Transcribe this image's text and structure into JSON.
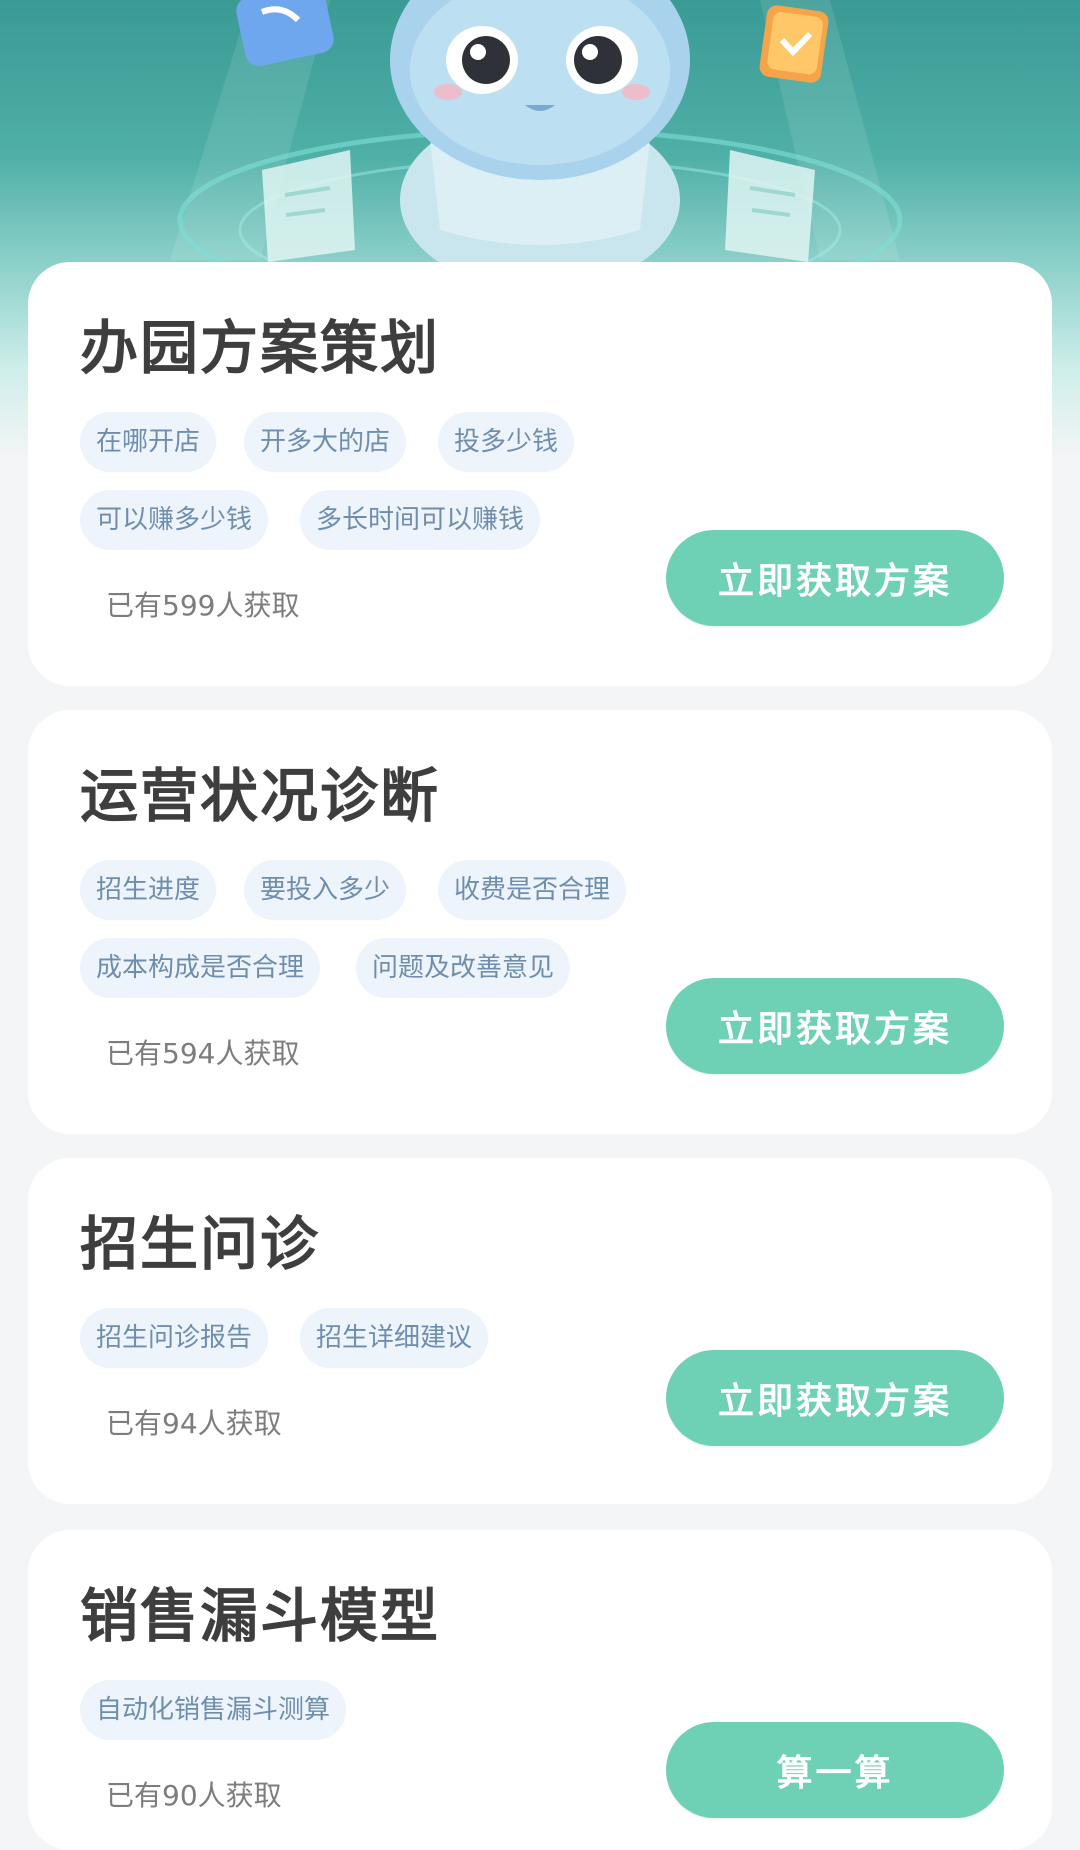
{
  "colors": {
    "accent": "#6ed1b6",
    "tag_bg": "#eef4fb",
    "tag_text": "#6f8eae",
    "title": "#3e3e3e",
    "hero_top": "#3a9a94"
  },
  "hero": {
    "illustration": "robot-mascot-illustration"
  },
  "cards": [
    {
      "title": "办园方案策划",
      "tags": [
        "在哪开店",
        "开多大的店",
        "投多少钱",
        "可以赚多少钱",
        "多长时间可以赚钱"
      ],
      "count": "已有599人获取",
      "button": "立即获取方案"
    },
    {
      "title": "运营状况诊断",
      "tags": [
        "招生进度",
        "要投入多少",
        "收费是否合理",
        "成本构成是否合理",
        "问题及改善意见"
      ],
      "count": "已有594人获取",
      "button": "立即获取方案"
    },
    {
      "title": "招生问诊",
      "tags": [
        "招生问诊报告",
        "招生详细建议"
      ],
      "count": "已有94人获取",
      "button": "立即获取方案"
    },
    {
      "title": "销售漏斗模型",
      "tags": [
        "自动化销售漏斗测算"
      ],
      "count": "已有90人获取",
      "button": "算一算"
    }
  ]
}
